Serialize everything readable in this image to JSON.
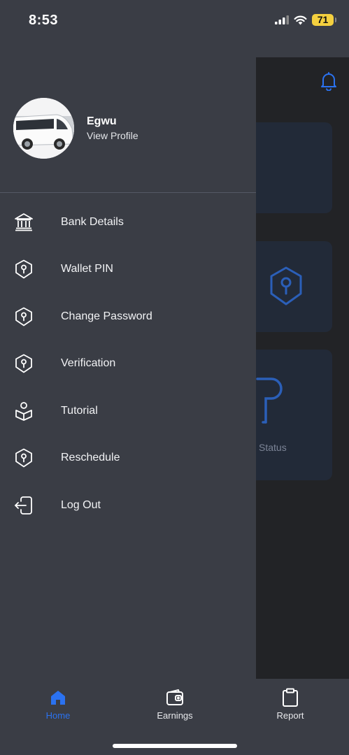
{
  "status_bar": {
    "time": "8:53",
    "battery": "71"
  },
  "background": {
    "status_label": "Status"
  },
  "profile": {
    "name": "Egwu",
    "link": "View Profile"
  },
  "menu": [
    {
      "label": "Bank Details",
      "icon": "bank-icon"
    },
    {
      "label": "Wallet PIN",
      "icon": "shield-key-icon"
    },
    {
      "label": "Change Password",
      "icon": "shield-key-icon"
    },
    {
      "label": "Verification",
      "icon": "shield-key-icon"
    },
    {
      "label": "Tutorial",
      "icon": "book-reader-icon"
    },
    {
      "label": "Reschedule",
      "icon": "shield-key-icon"
    },
    {
      "label": "Log Out",
      "icon": "logout-icon"
    }
  ],
  "tabs": [
    {
      "label": "Home",
      "icon": "home-icon",
      "active": true
    },
    {
      "label": "Earnings",
      "icon": "wallet-icon",
      "active": false
    },
    {
      "label": "Report",
      "icon": "clipboard-icon",
      "active": false
    }
  ],
  "colors": {
    "accent": "#2b72f0",
    "drawer": "#3a3d45",
    "overlay": "#222326"
  }
}
